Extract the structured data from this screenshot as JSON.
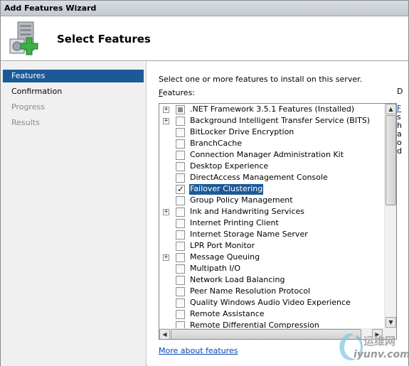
{
  "window": {
    "title": "Add Features Wizard"
  },
  "header": {
    "title": "Select Features",
    "icon": "server-add-icon"
  },
  "nav": {
    "items": [
      {
        "label": "Features",
        "state": "active"
      },
      {
        "label": "Confirmation",
        "state": "normal"
      },
      {
        "label": "Progress",
        "state": "disabled"
      },
      {
        "label": "Results",
        "state": "disabled"
      }
    ]
  },
  "content": {
    "instruction": "Select one or more features to install on this server.",
    "features_label_accel": "F",
    "features_label_rest": "eatures:",
    "features": [
      {
        "label": ".NET Framework 3.5.1 Features  (Installed)",
        "expandable": true,
        "checked": "partial"
      },
      {
        "label": "Background Intelligent Transfer Service (BITS)",
        "expandable": true,
        "checked": "no"
      },
      {
        "label": "BitLocker Drive Encryption",
        "expandable": false,
        "checked": "no"
      },
      {
        "label": "BranchCache",
        "expandable": false,
        "checked": "no"
      },
      {
        "label": "Connection Manager Administration Kit",
        "expandable": false,
        "checked": "no"
      },
      {
        "label": "Desktop Experience",
        "expandable": false,
        "checked": "no"
      },
      {
        "label": "DirectAccess Management Console",
        "expandable": false,
        "checked": "no"
      },
      {
        "label": "Failover Clustering",
        "expandable": false,
        "checked": "yes",
        "selected": true
      },
      {
        "label": "Group Policy Management",
        "expandable": false,
        "checked": "no"
      },
      {
        "label": "Ink and Handwriting Services",
        "expandable": true,
        "checked": "no"
      },
      {
        "label": "Internet Printing Client",
        "expandable": false,
        "checked": "no"
      },
      {
        "label": "Internet Storage Name Server",
        "expandable": false,
        "checked": "no"
      },
      {
        "label": "LPR Port Monitor",
        "expandable": false,
        "checked": "no"
      },
      {
        "label": "Message Queuing",
        "expandable": true,
        "checked": "no"
      },
      {
        "label": "Multipath I/O",
        "expandable": false,
        "checked": "no"
      },
      {
        "label": "Network Load Balancing",
        "expandable": false,
        "checked": "no"
      },
      {
        "label": "Peer Name Resolution Protocol",
        "expandable": false,
        "checked": "no"
      },
      {
        "label": "Quality Windows Audio Video Experience",
        "expandable": false,
        "checked": "no"
      },
      {
        "label": "Remote Assistance",
        "expandable": false,
        "checked": "no"
      },
      {
        "label": "Remote Differential Compression",
        "expandable": false,
        "checked": "no"
      }
    ],
    "more_link": "More about features",
    "description_fragments": [
      "D",
      "",
      "F",
      "s",
      "h",
      "a",
      "o",
      "d"
    ]
  },
  "watermark": {
    "cn": "运维网",
    "url": "iyunv.com"
  },
  "colors": {
    "selection": "#1c5a97",
    "link": "#0645ad",
    "nav_bg": "#f0f0f0"
  }
}
